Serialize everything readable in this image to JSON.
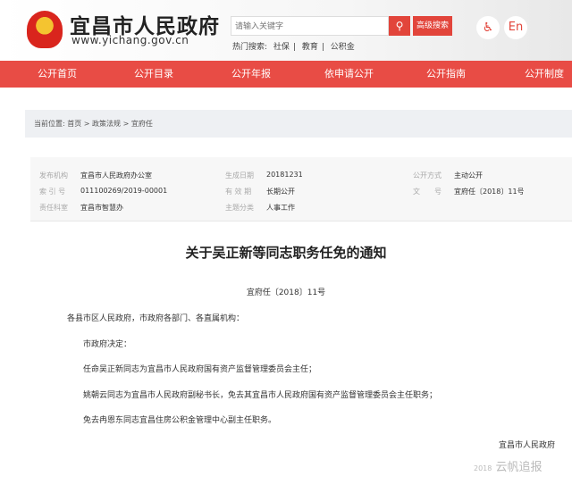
{
  "header": {
    "site_title": "宜昌市人民政府",
    "site_url": "www.yichang.gov.cn",
    "search_placeholder": "请输入关键字",
    "search_icon": "search-icon",
    "advanced_search": "高级搜索",
    "hot_label": "热门搜索:",
    "hot_terms": [
      "社保",
      "教育",
      "公积金"
    ],
    "separator": "|",
    "accessibility_icon": "♿",
    "english": "En"
  },
  "nav": [
    "公开首页",
    "公开目录",
    "公开年报",
    "依申请公开",
    "公开指南",
    "公开制度"
  ],
  "breadcrumb": {
    "label": "当前位置:",
    "items": [
      "首页",
      "政策法规",
      "宜府任"
    ],
    "sep": ">"
  },
  "meta": [
    {
      "k": "发布机构",
      "v": "宜昌市人民政府办公室"
    },
    {
      "k": "生成日期",
      "v": "20181231"
    },
    {
      "k": "公开方式",
      "v": "主动公开"
    },
    {
      "k": "索 引 号",
      "v": "011100269/2019-00001"
    },
    {
      "k": "有 效 期",
      "v": "长期公开"
    },
    {
      "k": "文　　号",
      "v": "宜府任〔2018〕11号"
    },
    {
      "k": "责任科室",
      "v": "宜昌市智慧办"
    },
    {
      "k": "主题分类",
      "v": "人事工作"
    }
  ],
  "doc": {
    "title": "关于吴正新等同志职务任免的通知",
    "number": "宜府任〔2018〕11号",
    "paragraphs": [
      "各县市区人民政府，市政府各部门、各直属机构：",
      "市政府决定：",
      "任命吴正新同志为宜昌市人民政府国有资产监督管理委员会主任；",
      "姚朝云同志为宜昌市人民政府副秘书长，免去其宜昌市人民政府国有资产监督管理委员会主任职务；",
      "免去冉恩东同志宜昌住房公积金管理中心副主任职务。"
    ],
    "signature": "宜昌市人民政府",
    "date_partial": "2018"
  },
  "watermark": "云帆追报"
}
